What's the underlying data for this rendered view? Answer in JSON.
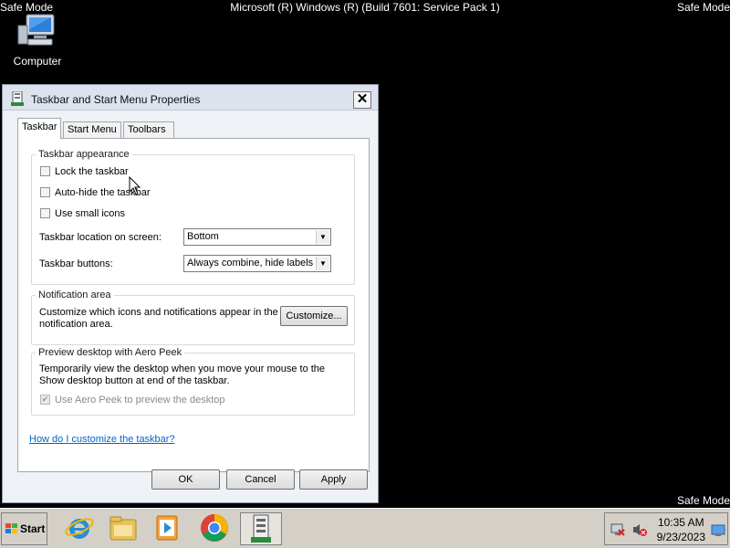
{
  "desktop": {
    "safe_mode_label": "Safe Mode",
    "build_text": "Microsoft (R) Windows (R) (Build 7601: Service Pack 1)",
    "computer_label": "Computer"
  },
  "dialog": {
    "title": "Taskbar and Start Menu Properties",
    "tabs": [
      "Taskbar",
      "Start Menu",
      "Toolbars"
    ],
    "appearance": {
      "legend": "Taskbar appearance",
      "lock_label": "Lock the taskbar",
      "autohide_label": "Auto-hide the taskbar",
      "small_icons_label": "Use small icons",
      "location_label": "Taskbar location on screen:",
      "location_value": "Bottom",
      "buttons_label": "Taskbar buttons:",
      "buttons_value": "Always combine, hide labels"
    },
    "notification": {
      "legend": "Notification area",
      "text": "Customize which icons and notifications appear in the notification area.",
      "customize_label": "Customize..."
    },
    "aero_peek": {
      "legend": "Preview desktop with Aero Peek",
      "text": "Temporarily view the desktop when you move your mouse to the Show desktop button at end of the taskbar.",
      "checkbox_label": "Use Aero Peek to preview the desktop"
    },
    "help_link": "How do I customize the taskbar?",
    "ok_label": "OK",
    "cancel_label": "Cancel",
    "apply_label": "Apply"
  },
  "taskbar": {
    "start_label": "Start",
    "pinned": [
      "internet-explorer-icon",
      "folder-icon",
      "media-player-icon",
      "chrome-icon",
      "properties-window-icon"
    ],
    "time": "10:35 AM",
    "date": "9/23/2023"
  },
  "colors": {
    "desktop_bg": "#000000",
    "dialog_bg": "#eef1f5",
    "link": "#0066cc",
    "taskbar_bg": "#d4d0c8"
  }
}
